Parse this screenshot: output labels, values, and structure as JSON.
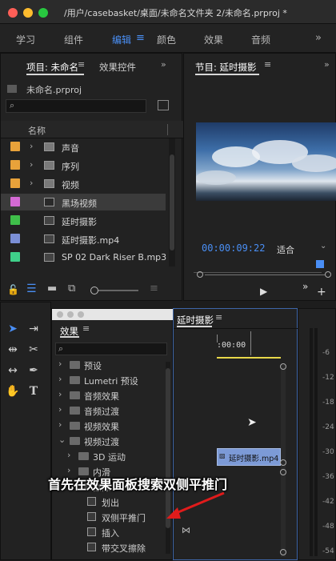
{
  "window": {
    "title": "/用户/casebasket/桌面/未命名文件夹 2/未命名.prproj *"
  },
  "workspaces": [
    "学习",
    "组件",
    "编辑",
    "颜色",
    "效果",
    "音频"
  ],
  "workspace_active": "编辑",
  "project_panel": {
    "tab_project": "项目: 未命名",
    "tab_effect_controls": "效果控件",
    "filename": "未命名.prproj",
    "column_name": "名称",
    "items": [
      {
        "label": "声音",
        "color": "#e8a23a",
        "type": "bin"
      },
      {
        "label": "序列",
        "color": "#e8a23a",
        "type": "bin"
      },
      {
        "label": "视频",
        "color": "#e8a23a",
        "type": "bin"
      },
      {
        "label": "黑场视频",
        "color": "#d46ad4",
        "type": "black"
      },
      {
        "label": "延时摄影",
        "color": "#3fbf4a",
        "type": "sequence"
      },
      {
        "label": "延时摄影.mp4",
        "color": "#7b8fd6",
        "type": "video"
      },
      {
        "label": "SP 02 Dark Riser B.mp3",
        "color": "#3fd08a",
        "type": "audio"
      }
    ]
  },
  "program_monitor": {
    "title": "节目: 延时摄影",
    "timecode": "00:00:09:22",
    "fit": "适合"
  },
  "effects_panel": {
    "title": "效果",
    "items": [
      {
        "label": "预设",
        "indent": 0,
        "kind": "folder",
        "open": false
      },
      {
        "label": "Lumetri 预设",
        "indent": 0,
        "kind": "folder",
        "open": false
      },
      {
        "label": "音频效果",
        "indent": 0,
        "kind": "folder",
        "open": false
      },
      {
        "label": "音频过渡",
        "indent": 0,
        "kind": "folder",
        "open": false
      },
      {
        "label": "视频效果",
        "indent": 0,
        "kind": "folder",
        "open": false
      },
      {
        "label": "视频过渡",
        "indent": 0,
        "kind": "folder",
        "open": true
      },
      {
        "label": "3D 运动",
        "indent": 1,
        "kind": "folder",
        "open": false
      },
      {
        "label": "内滑",
        "indent": 1,
        "kind": "folder",
        "open": false
      },
      {
        "label": "擦除",
        "indent": 1,
        "kind": "folder",
        "open": true
      },
      {
        "label": "划出",
        "indent": 2,
        "kind": "effect"
      },
      {
        "label": "双侧平推门",
        "indent": 2,
        "kind": "effect"
      },
      {
        "label": "插入",
        "indent": 2,
        "kind": "effect"
      },
      {
        "label": "带交叉擦除",
        "indent": 2,
        "kind": "effect"
      }
    ]
  },
  "timeline": {
    "title": "延时摄影",
    "ruler_time": ":00:00",
    "clip_label": "延时摄影.mp4"
  },
  "audio_meter": {
    "labels": [
      "-6",
      "-12",
      "-18",
      "-24",
      "-30",
      "-36",
      "-42",
      "-48",
      "-54"
    ]
  },
  "caption": "首先在效果面板搜索双侧平推门"
}
